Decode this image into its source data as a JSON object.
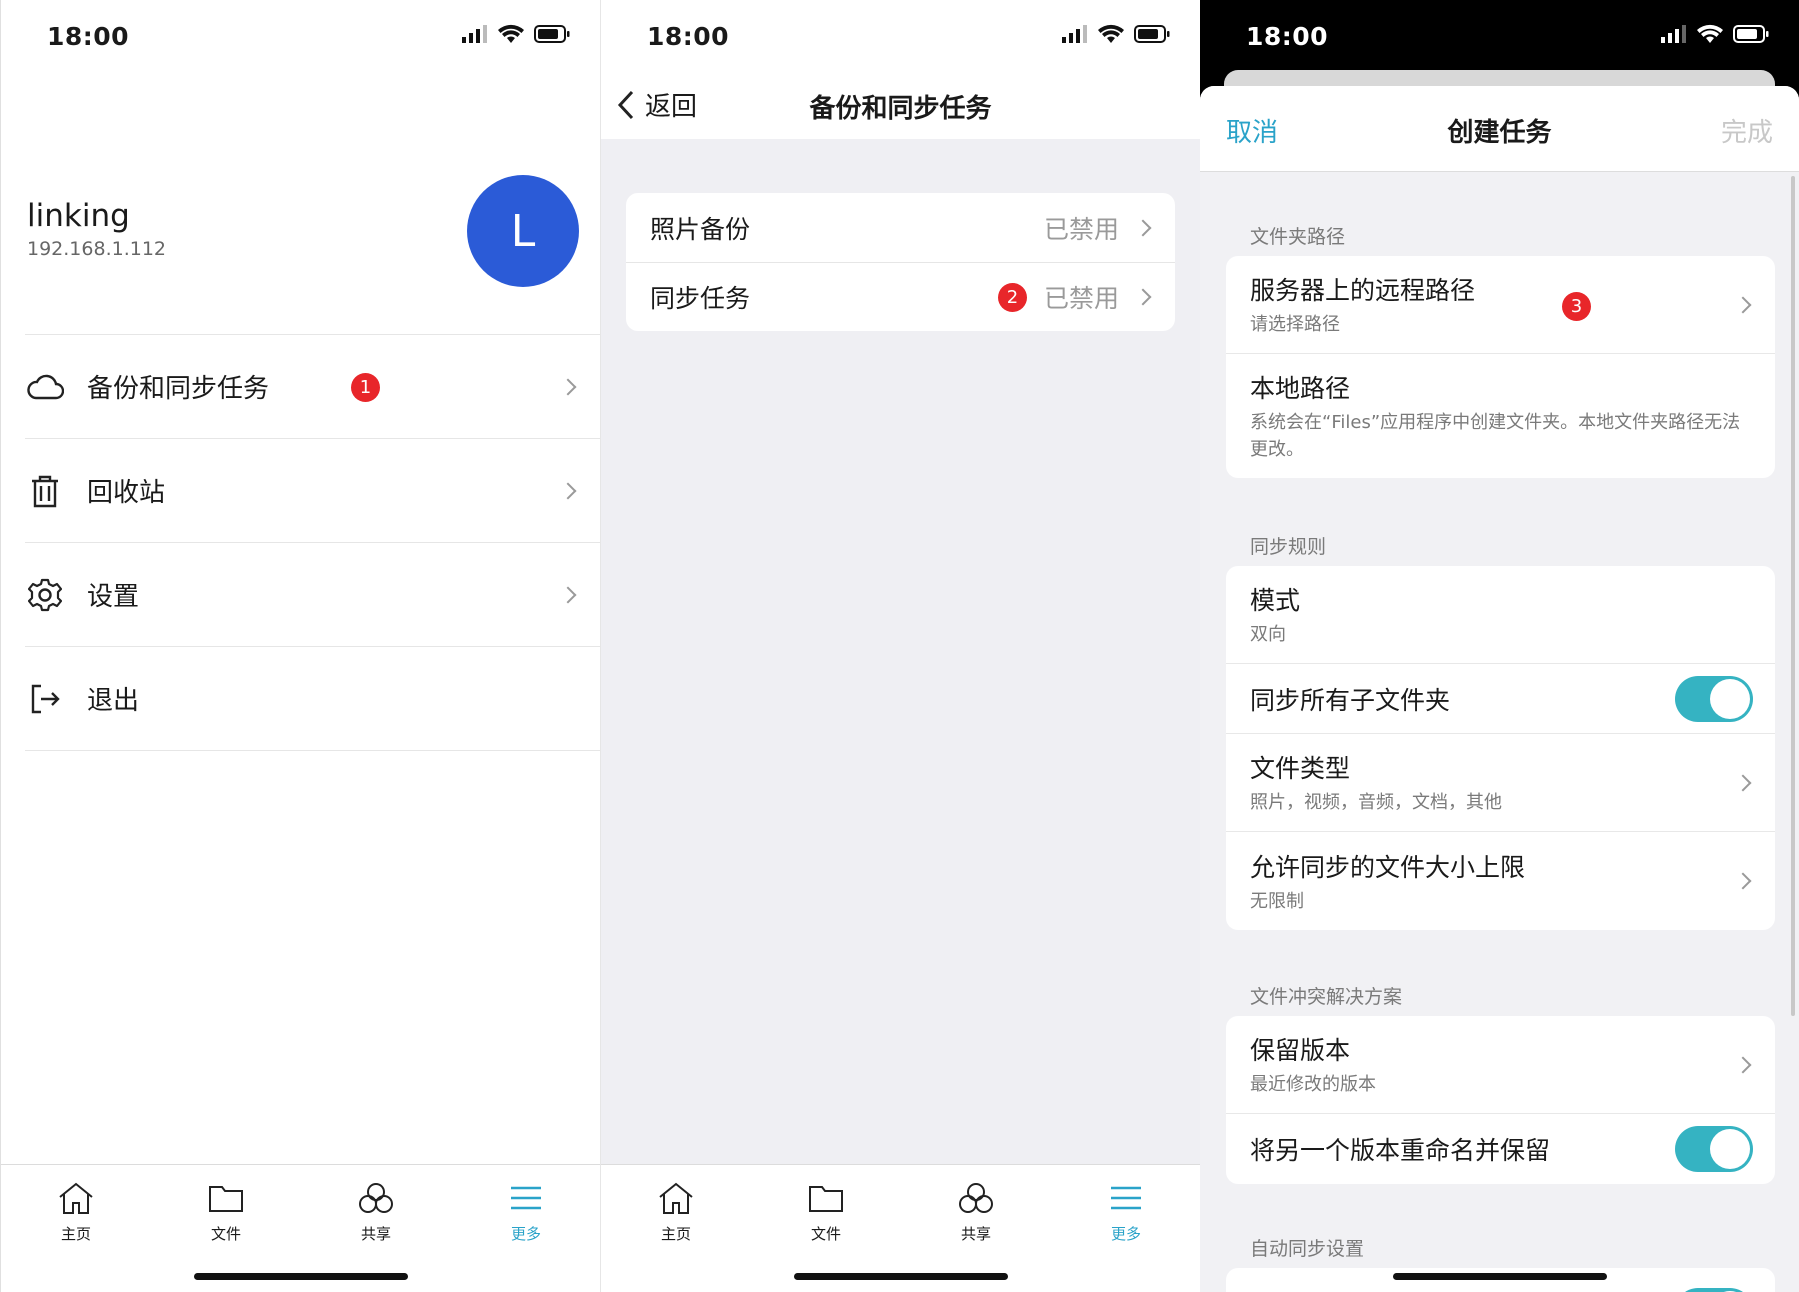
{
  "colors": {
    "accent": "#2aa3c9",
    "avatar": "#2b5bd7",
    "badge": "#e8262a",
    "toggle_on": "#35b3c2"
  },
  "status": {
    "time": "18:00"
  },
  "panel1": {
    "account": {
      "name": "linking",
      "ip": "192.168.1.112",
      "avatar_letter": "L"
    },
    "menu": [
      {
        "label": "备份和同步任务",
        "icon": "cloud-icon",
        "badge": "1"
      },
      {
        "label": "回收站",
        "icon": "trash-icon"
      },
      {
        "label": "设置",
        "icon": "gear-icon"
      },
      {
        "label": "退出",
        "icon": "logout-icon"
      }
    ]
  },
  "tabs": [
    {
      "label": "主页",
      "icon": "home-icon"
    },
    {
      "label": "文件",
      "icon": "folder-icon"
    },
    {
      "label": "共享",
      "icon": "share-icon"
    },
    {
      "label": "更多",
      "icon": "menu-icon",
      "active": true
    }
  ],
  "panel2": {
    "back_label": "返回",
    "title": "备份和同步任务",
    "rows": [
      {
        "label": "照片备份",
        "value": "已禁用"
      },
      {
        "label": "同步任务",
        "value": "已禁用",
        "badge": "2"
      }
    ]
  },
  "panel3": {
    "cancel": "取消",
    "title": "创建任务",
    "done": "完成",
    "sections": {
      "folder_path": "文件夹路径",
      "sync_rules": "同步规则",
      "conflict": "文件冲突解决方案",
      "auto_sync": "自动同步设置"
    },
    "remote_path": {
      "title": "服务器上的远程路径",
      "sub": "请选择路径",
      "badge": "3"
    },
    "local_path": {
      "title": "本地路径",
      "sub": "系统会在“Files”应用程序中创建文件夹。本地文件夹路径无法更改。"
    },
    "mode": {
      "title": "模式",
      "sub": "双向"
    },
    "sync_all_subfolders": {
      "title": "同步所有子文件夹",
      "on": true
    },
    "file_types": {
      "title": "文件类型",
      "sub": "照片，视频，音频，文档，其他"
    },
    "size_limit": {
      "title": "允许同步的文件大小上限",
      "sub": "无限制"
    },
    "keep_version": {
      "title": "保留版本",
      "sub": "最近修改的版本"
    },
    "rename_keep": {
      "title": "将另一个版本重命名并保留",
      "on": true
    }
  }
}
